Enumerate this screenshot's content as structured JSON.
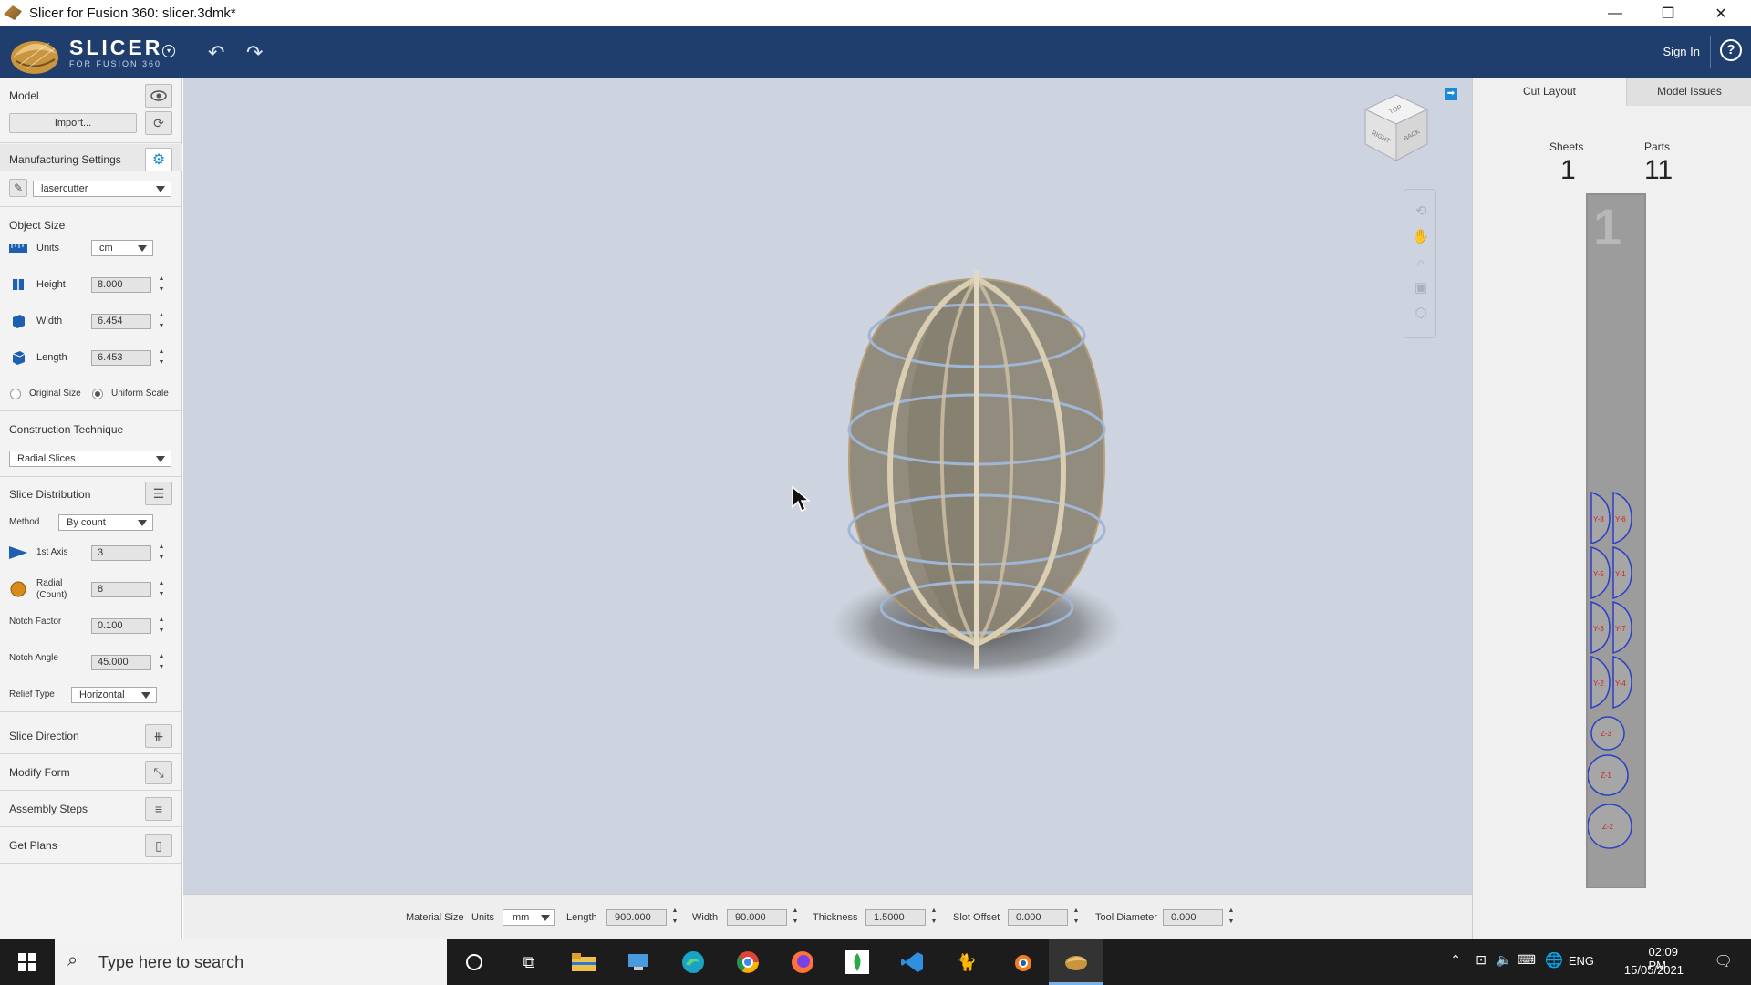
{
  "window": {
    "title": "Slicer for Fusion 360: slicer.3dmk*",
    "controls": {
      "minimize": "—",
      "restore": "❐",
      "close": "✕"
    }
  },
  "header": {
    "logo_title": "SLICER",
    "logo_subtitle": "FOR FUSION 360",
    "undo_icon": "↶",
    "redo_icon": "↷",
    "sign_in": "Sign In",
    "help": "?"
  },
  "left_panel": {
    "model": {
      "label": "Model",
      "import_button": "Import..."
    },
    "manufacturing": {
      "label": "Manufacturing Settings",
      "profile": "lasercutter"
    },
    "object_size": {
      "title": "Object Size",
      "units_label": "Units",
      "units_value": "cm",
      "height_label": "Height",
      "height_value": "8.000",
      "width_label": "Width",
      "width_value": "6.454",
      "length_label": "Length",
      "length_value": "6.453",
      "original_size": "Original Size",
      "uniform_scale": "Uniform Scale"
    },
    "construction": {
      "title": "Construction Technique",
      "value": "Radial Slices"
    },
    "slice_distribution": {
      "title": "Slice Distribution",
      "method_label": "Method",
      "method_value": "By count",
      "axis1_label": "1st Axis",
      "axis1_value": "3",
      "radial_label_1": "Radial",
      "radial_label_2": "(Count)",
      "radial_value": "8",
      "notch_factor_label": "Notch Factor",
      "notch_factor_value": "0.100",
      "notch_angle_label": "Notch Angle",
      "notch_angle_value": "45.000",
      "relief_type_label": "Relief Type",
      "relief_type_value": "Horizontal"
    },
    "sections": {
      "slice_direction": "Slice Direction",
      "modify_form": "Modify Form",
      "assembly_steps": "Assembly Steps",
      "get_plans": "Get Plans"
    }
  },
  "viewcube": {
    "top": "TOP",
    "right": "RIGHT",
    "back": "BACK"
  },
  "bottom_bar": {
    "material_size": "Material Size",
    "units_label": "Units",
    "units_value": "mm",
    "length_label": "Length",
    "length_value": "900.000",
    "width_label": "Width",
    "width_value": "90.000",
    "thickness_label": "Thickness",
    "thickness_value": "1.5000",
    "slot_offset_label": "Slot Offset",
    "slot_offset_value": "0.000",
    "tool_diameter_label": "Tool Diameter",
    "tool_diameter_value": "0.000"
  },
  "right_panel": {
    "tabs": [
      "Cut Layout",
      "Model Issues"
    ],
    "sheets_label": "Sheets",
    "sheets_value": "1",
    "parts_label": "Parts",
    "parts_value": "11",
    "sheet_number": "1",
    "part_labels": [
      "Y-8",
      "Y-6",
      "Y-5",
      "Y-1",
      "Y-3",
      "Y-7",
      "Y-2",
      "Y-4",
      "Z-3",
      "Z-1",
      "Z-2"
    ]
  },
  "taskbar": {
    "search_placeholder": "Type here to search",
    "language": "ENG",
    "time": "02:09 PM",
    "date": "15/05/2021"
  },
  "colors": {
    "header": "#1f3e6e",
    "viewport": "#cdd4df",
    "accent": "#1a8ad8",
    "part_outline": "#2b3fc7",
    "part_label": "#d02020"
  }
}
